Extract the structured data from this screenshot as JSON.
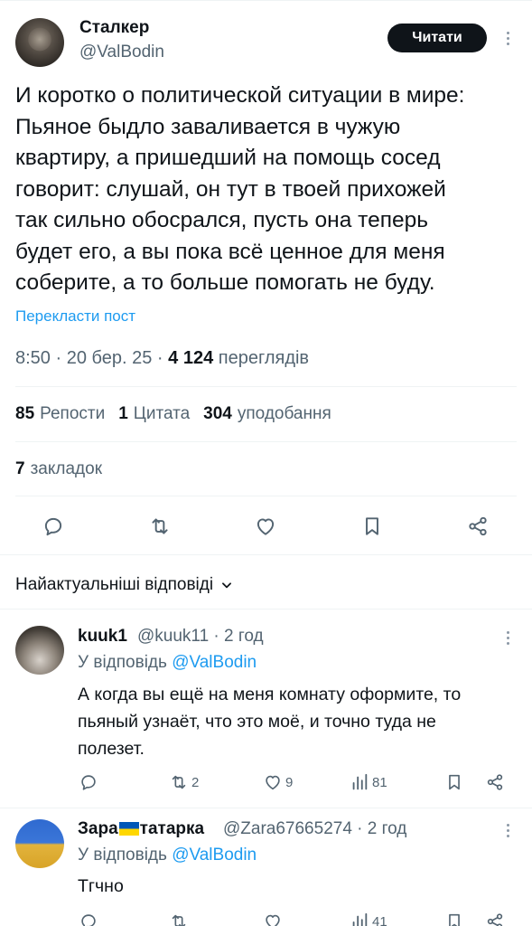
{
  "tweet": {
    "author_name": "Сталкер",
    "author_handle": "@ValBodin",
    "follow_label": "Читати",
    "text": "И коротко о политической ситуации в мире:\nПьяное быдло заваливается в чужую\nквартиру, а пришедший на помощь сосед\nговорит: слушай, он тут в твоей прихожей\nтак сильно обосрался, пусть она теперь\nбудет его, а вы пока всё ценное для меня\nсоберите, а то больше помогать не буду.",
    "translate_label": "Перекласти пост",
    "time": "8:50",
    "date": "20 бер. 25",
    "views_count": "4 124",
    "views_label": "переглядів",
    "reposts_count": "85",
    "reposts_label": "Репости",
    "quotes_count": "1",
    "quotes_label": "Цитата",
    "likes_count": "304",
    "likes_label": "уподобання",
    "bookmarks_count": "7",
    "bookmarks_label": "закладок"
  },
  "replies_sort_label": "Найактуальніші відповіді",
  "replies": [
    {
      "name": "kuuk1",
      "handle": "@kuuk11",
      "time": "2 год",
      "replying_prefix": "У відповідь",
      "replying_to": "@ValBodin",
      "text": "А когда вы ещё на меня комнату оформите, то\nпьяный узнаёт, что это моё, и точно туда не\nполезет.",
      "retweets": "2",
      "likes": "9",
      "views": "81"
    },
    {
      "name_part1": "Зара",
      "name_part2": "татарка",
      "handle": "@Zara67665274",
      "time": "2 год",
      "replying_prefix": "У відповідь",
      "replying_to": "@ValBodin",
      "text": "Тгчно",
      "views": "41"
    }
  ],
  "icons": [
    "reply-icon",
    "retweet-icon",
    "like-icon",
    "bookmark-icon",
    "share-icon",
    "views-icon",
    "more-icon",
    "chevron-down-icon"
  ],
  "colors": {
    "accent": "#1d9bf0",
    "text": "#0f1419",
    "secondary": "#536471"
  }
}
